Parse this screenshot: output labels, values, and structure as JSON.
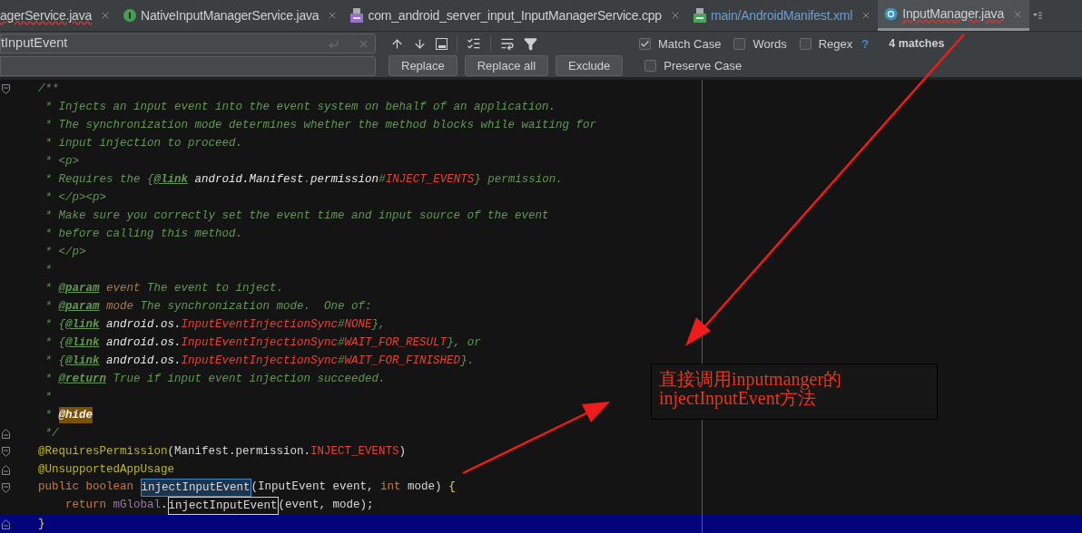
{
  "tabs": [
    {
      "label": "agerService.java",
      "kind": "plain",
      "selected": false,
      "errors": true,
      "modified": false
    },
    {
      "label": "NativeInputManagerService.java",
      "kind": "interface",
      "selected": false,
      "errors": false,
      "modified": false
    },
    {
      "label": "com_android_server_input_InputManagerService.cpp",
      "kind": "cpp",
      "selected": false,
      "errors": false,
      "modified": false
    },
    {
      "label": "main/AndroidManifest.xml",
      "kind": "manifest",
      "selected": false,
      "errors": false,
      "modified": true
    },
    {
      "label": "InputManager.java",
      "kind": "class",
      "selected": true,
      "errors": true,
      "modified": false
    }
  ],
  "search": {
    "value": "tInputEvent",
    "buttons": [
      "Replace",
      "Replace all",
      "Exclude"
    ],
    "options": [
      {
        "label": "Match Case",
        "checked": true
      },
      {
        "label": "Words",
        "checked": false
      },
      {
        "label": "Regex",
        "checked": false
      }
    ],
    "help": "?",
    "matches": "4 matches",
    "preserve_case": {
      "label": "Preserve Case",
      "checked": false
    }
  },
  "code_lines": [
    {
      "kind": "fold-start",
      "current": false,
      "segments": [
        {
          "text": "    /**",
          "kind": "comment"
        }
      ]
    },
    {
      "current": false,
      "segments": [
        {
          "text": "     * Injects an input event into the event system on behalf of an application.",
          "kind": "comment"
        }
      ]
    },
    {
      "current": false,
      "segments": [
        {
          "text": "     * The synchronization mode determines whether the method blocks while waiting for",
          "kind": "comment"
        }
      ]
    },
    {
      "current": false,
      "segments": [
        {
          "text": "     * input injection to proceed.",
          "kind": "comment"
        }
      ]
    },
    {
      "current": false,
      "segments": [
        {
          "text": "     * <p>",
          "kind": "comment"
        }
      ]
    },
    {
      "current": false,
      "segments": [
        {
          "text": "     * Requires the {",
          "kind": "comment"
        },
        {
          "text": "@link",
          "kind": "tag"
        },
        {
          "text": " android.Manifest",
          "kind": "ref"
        },
        {
          "text": ".",
          "kind": "comment"
        },
        {
          "text": "permission",
          "kind": "ref"
        },
        {
          "text": "#",
          "kind": "comment"
        },
        {
          "text": "INJECT_EVENTS",
          "kind": "constant"
        },
        {
          "text": "} permission.",
          "kind": "comment"
        }
      ]
    },
    {
      "current": false,
      "segments": [
        {
          "text": "     * </p><p>",
          "kind": "comment"
        }
      ]
    },
    {
      "current": false,
      "segments": [
        {
          "text": "     * Make sure you correctly set the event time and input source of the event",
          "kind": "comment"
        }
      ]
    },
    {
      "current": false,
      "segments": [
        {
          "text": "     * before calling this method.",
          "kind": "comment"
        }
      ]
    },
    {
      "current": false,
      "segments": [
        {
          "text": "     * </p>",
          "kind": "comment"
        }
      ]
    },
    {
      "current": false,
      "segments": [
        {
          "text": "     *",
          "kind": "comment"
        }
      ]
    },
    {
      "current": false,
      "segments": [
        {
          "text": "     * ",
          "kind": "comment"
        },
        {
          "text": "@param",
          "kind": "tag"
        },
        {
          "text": " event",
          "kind": "param"
        },
        {
          "text": " The event to inject.",
          "kind": "comment"
        }
      ]
    },
    {
      "current": false,
      "segments": [
        {
          "text": "     * ",
          "kind": "comment"
        },
        {
          "text": "@param",
          "kind": "tag"
        },
        {
          "text": " mode",
          "kind": "param"
        },
        {
          "text": " The synchronization mode.  One of:",
          "kind": "comment"
        }
      ]
    },
    {
      "current": false,
      "segments": [
        {
          "text": "     * {",
          "kind": "comment"
        },
        {
          "text": "@link",
          "kind": "tag"
        },
        {
          "text": " android.os.",
          "kind": "ref"
        },
        {
          "text": "InputEventInjectionSync",
          "kind": "constant"
        },
        {
          "text": "#",
          "kind": "comment"
        },
        {
          "text": "NONE",
          "kind": "constant"
        },
        {
          "text": "},",
          "kind": "comment"
        }
      ]
    },
    {
      "current": false,
      "segments": [
        {
          "text": "     * {",
          "kind": "comment"
        },
        {
          "text": "@link",
          "kind": "tag"
        },
        {
          "text": " android.os.",
          "kind": "ref"
        },
        {
          "text": "InputEventInjectionSync",
          "kind": "constant"
        },
        {
          "text": "#",
          "kind": "comment"
        },
        {
          "text": "WAIT_FOR_RESULT",
          "kind": "constant"
        },
        {
          "text": "}, or",
          "kind": "comment"
        }
      ]
    },
    {
      "current": false,
      "segments": [
        {
          "text": "     * {",
          "kind": "comment"
        },
        {
          "text": "@link",
          "kind": "tag"
        },
        {
          "text": " android.os.",
          "kind": "ref"
        },
        {
          "text": "InputEventInjectionSync",
          "kind": "constant"
        },
        {
          "text": "#",
          "kind": "comment"
        },
        {
          "text": "WAIT_FOR_FINISHED",
          "kind": "constant"
        },
        {
          "text": "}.",
          "kind": "comment"
        }
      ]
    },
    {
      "current": false,
      "segments": [
        {
          "text": "     * ",
          "kind": "comment"
        },
        {
          "text": "@return",
          "kind": "tag"
        },
        {
          "text": " True if input event injection succeeded.",
          "kind": "comment"
        }
      ]
    },
    {
      "current": false,
      "segments": [
        {
          "text": "     *",
          "kind": "comment"
        }
      ]
    },
    {
      "current": false,
      "segments": [
        {
          "text": "     * ",
          "kind": "comment"
        },
        {
          "text": "@hide",
          "kind": "hide"
        }
      ]
    },
    {
      "kind": "fold-end",
      "current": false,
      "segments": [
        {
          "text": "     */",
          "kind": "comment"
        }
      ]
    },
    {
      "kind": "fold-start",
      "current": false,
      "segments": [
        {
          "text": "    @RequiresPermission",
          "kind": "annotation"
        },
        {
          "text": "(Manifest.permission.",
          "kind": "plain"
        },
        {
          "text": "INJECT_EVENTS",
          "kind": "static"
        },
        {
          "text": ")",
          "kind": "plain"
        }
      ]
    },
    {
      "kind": "fold-end",
      "current": false,
      "segments": [
        {
          "text": "    @UnsupportedAppUsage",
          "kind": "annotation"
        }
      ]
    },
    {
      "kind": "fold-start",
      "current": false,
      "segments": [
        {
          "text": "    public boolean ",
          "kind": "keyword"
        },
        {
          "text": "injectInputEvent",
          "kind": "match"
        },
        {
          "text": "(InputEvent event, ",
          "kind": "plain"
        },
        {
          "text": "int",
          "kind": "keyword"
        },
        {
          "text": " mode) ",
          "kind": "plain"
        },
        {
          "text": "{",
          "kind": "brace"
        }
      ]
    },
    {
      "current": false,
      "segments": [
        {
          "text": "        return ",
          "kind": "keyword"
        },
        {
          "text": "mGlobal",
          "kind": "field"
        },
        {
          "text": ".",
          "kind": "plain"
        },
        {
          "text": "injectInputEvent",
          "kind": "current-match"
        },
        {
          "text": "(event, mode);",
          "kind": "plain"
        }
      ]
    },
    {
      "kind": "fold-end",
      "current": true,
      "segments": [
        {
          "text": "    }",
          "kind": "brace"
        }
      ]
    }
  ],
  "note": {
    "lines": [
      "直接调用inputmanger的",
      "injectInputEvent方法"
    ]
  }
}
